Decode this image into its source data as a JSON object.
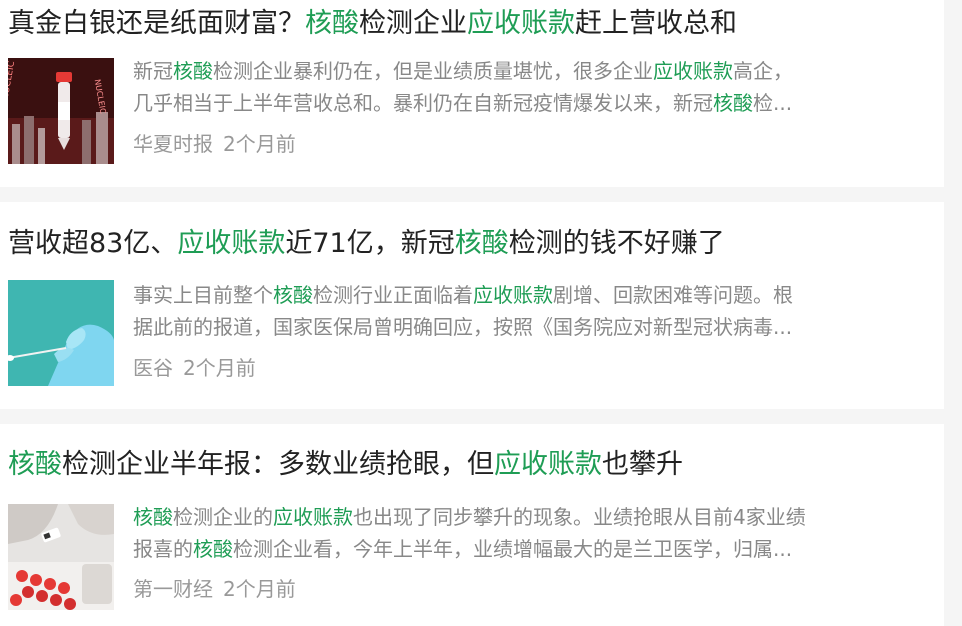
{
  "articles": [
    {
      "title_parts": [
        "真金白银还是纸面财富？",
        "核酸",
        "检测企业",
        "应收账款",
        "赶上营收总和"
      ],
      "summary_line1": [
        "新冠",
        "核酸",
        "检测企业暴利仍在，但是业绩质量堪忧，很多企业",
        "应收账款",
        "高企，"
      ],
      "summary_line2": [
        "几乎相当于上半年营收总和。暴利仍在自新冠疫情爆发以来，新冠",
        "核酸",
        "检..."
      ],
      "source": "华夏时报",
      "time": "2个月前",
      "thumb_text": "NUCLEIC"
    },
    {
      "title_parts": [
        "营收超83亿、",
        "应收账款",
        "近71亿，新冠",
        "核酸",
        "检测的钱不好赚了"
      ],
      "summary_line1": [
        "事实上目前整个",
        "核酸",
        "检测行业正面临着",
        "应收账款",
        "剧增、回款困难等问题。根"
      ],
      "summary_line2": [
        "据此前的报道，国家医保局曾明确回应，按照《国务院应对新型冠状病毒..."
      ],
      "source": "医谷",
      "time": "2个月前"
    },
    {
      "title_parts": [
        "核酸",
        "检测企业半年报：多数业绩抢眼，但",
        "应收账款",
        "也攀升"
      ],
      "summary_line1": [
        "核酸",
        "检测企业的",
        "应收账款",
        "也出现了同步攀升的现象。业绩抢眼从目前4家业绩"
      ],
      "summary_line2": [
        "报喜的",
        "核酸",
        "检测企业看，今年上半年，业绩增幅最大的是兰卫医学，归属..."
      ],
      "source": "第一财经",
      "time": "2个月前"
    }
  ],
  "colors": {
    "highlight": "#1f9d55",
    "title": "#222222",
    "summary": "#888888",
    "meta": "#999999",
    "background": "#f5f5f5"
  }
}
